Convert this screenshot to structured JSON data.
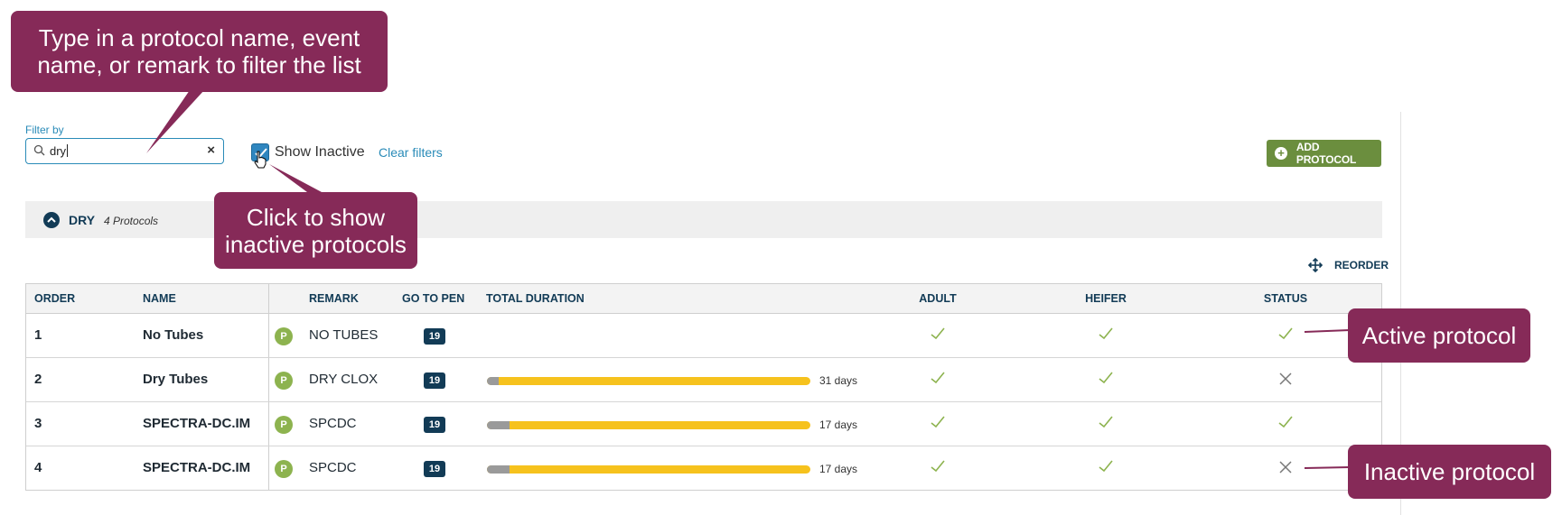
{
  "filter": {
    "label": "Filter by",
    "value": "dry",
    "clear_icon": "×",
    "show_inactive_label": "Show Inactive",
    "show_inactive_checked": true,
    "clear_filters_label": "Clear filters"
  },
  "toolbar": {
    "add_protocol_label": "ADD PROTOCOL",
    "reorder_label": "REORDER"
  },
  "group": {
    "name": "DRY",
    "count_label": "4 Protocols"
  },
  "table": {
    "headers": {
      "order": "ORDER",
      "name": "NAME",
      "remark": "REMARK",
      "go_to_pen": "GO TO PEN",
      "total_duration": "TOTAL DURATION",
      "adult": "ADULT",
      "heifer": "HEIFER",
      "status": "STATUS"
    },
    "rows": [
      {
        "order": "1",
        "name": "No Tubes",
        "badge": "P",
        "remark": "NO TUBES",
        "pen": "19",
        "duration_label": "",
        "pre_fraction": 0,
        "adult": "check",
        "heifer": "check",
        "status": "check"
      },
      {
        "order": "2",
        "name": "Dry Tubes",
        "badge": "P",
        "remark": "DRY CLOX",
        "pen": "19",
        "duration_label": "31 days",
        "pre_fraction": 0.035,
        "adult": "check",
        "heifer": "check",
        "status": "x"
      },
      {
        "order": "3",
        "name": "SPECTRA-DC.IM",
        "badge": "P",
        "remark": "SPCDC",
        "pen": "19",
        "duration_label": "17 days",
        "pre_fraction": 0.07,
        "adult": "check",
        "heifer": "check",
        "status": "check"
      },
      {
        "order": "4",
        "name": "SPECTRA-DC.IM",
        "badge": "P",
        "remark": "SPCDC",
        "pen": "19",
        "duration_label": "17 days",
        "pre_fraction": 0.07,
        "adult": "check",
        "heifer": "check",
        "status": "x"
      }
    ]
  },
  "callouts": {
    "filter_tip": "Type in a protocol name, event name, or remark to filter the list",
    "inactive_tip": "Click to show inactive protocols",
    "active_protocol": "Active protocol",
    "inactive_protocol": "Inactive protocol"
  },
  "icons": {
    "search": "search-icon",
    "checkbox": "checkmark-icon",
    "cursor": "hand-pointer-icon",
    "add": "plus-circle-icon",
    "group_toggle": "chevron-up-icon",
    "reorder": "move-arrows-icon",
    "check": "check-icon",
    "x": "x-icon"
  },
  "colors": {
    "brand_dark": "#123b56",
    "link": "#2a8bb8",
    "add_button": "#6b8e3e",
    "badge_p": "#8db34f",
    "duration_bar": "#f6c21d",
    "duration_pre": "#9a9a9a",
    "callout": "#862a58",
    "check": "#8db34f"
  }
}
